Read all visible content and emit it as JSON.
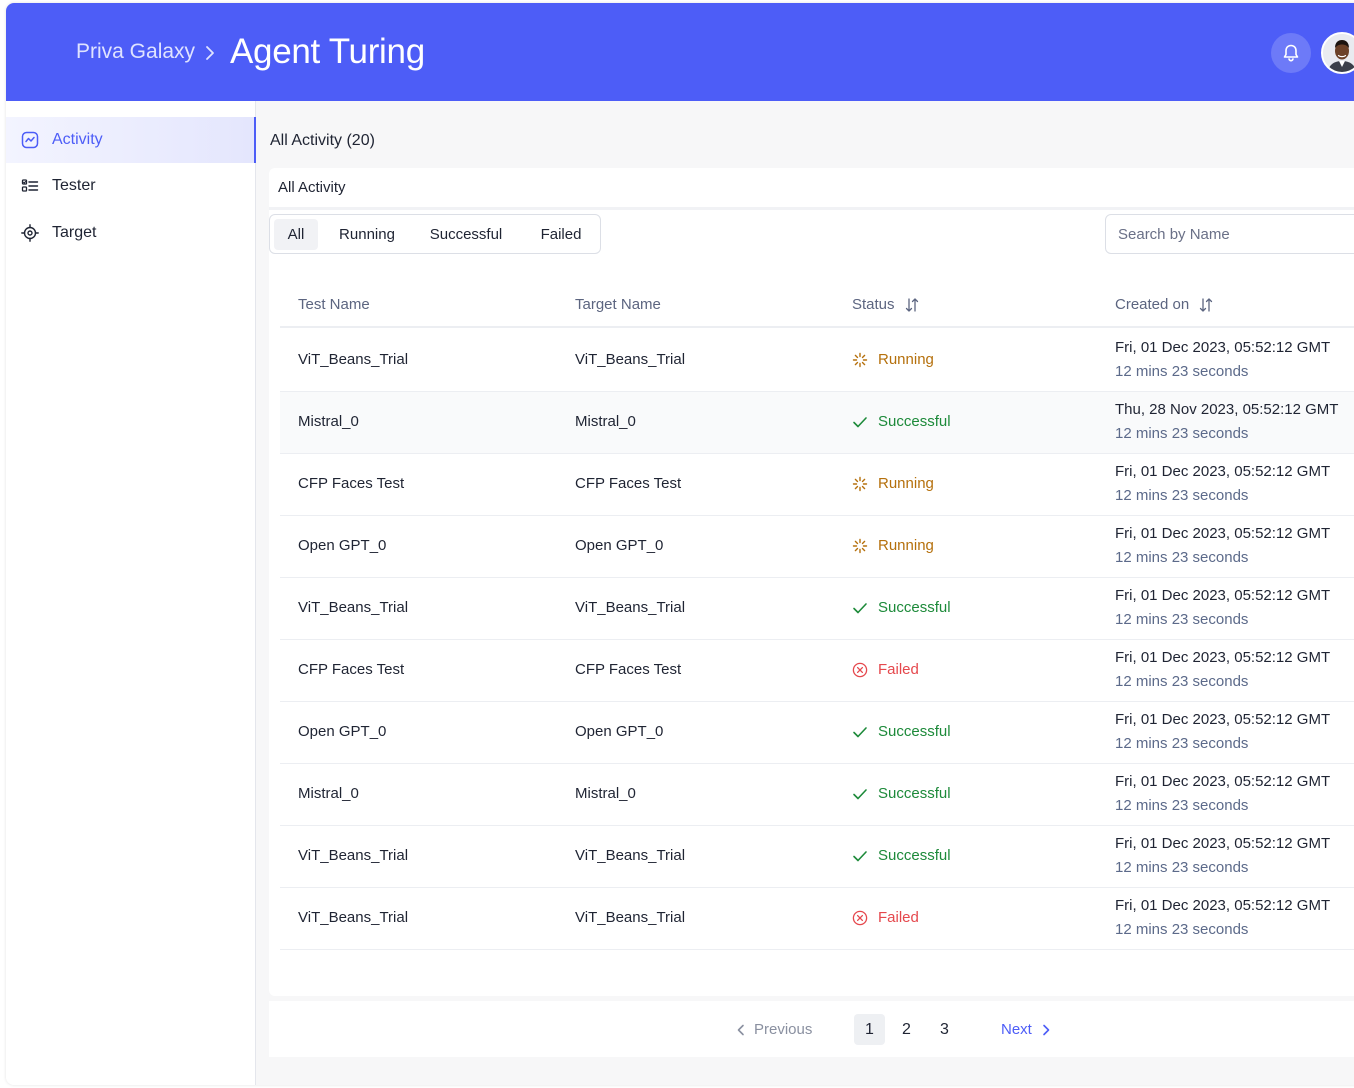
{
  "header": {
    "parent": "Priva Galaxy",
    "title": "Agent Turing",
    "bell_icon": "bell-icon",
    "avatar_icon": "user-avatar"
  },
  "sidebar": {
    "items": [
      {
        "label": "Activity",
        "icon": "activity-chart-icon",
        "active": true
      },
      {
        "label": "Tester",
        "icon": "checklist-icon",
        "active": false
      },
      {
        "label": "Target",
        "icon": "target-icon",
        "active": false
      }
    ]
  },
  "main": {
    "heading": "All Activity (20)",
    "card_title": "All Activity",
    "filters": [
      "All",
      "Running",
      "Successful",
      "Failed"
    ],
    "active_filter": "All",
    "search_placeholder": "Search by Name"
  },
  "table": {
    "columns": {
      "test_name": "Test Name",
      "target_name": "Target Name",
      "status": "Status",
      "created_on": "Created on"
    },
    "rows": [
      {
        "test": "ViT_Beans_Trial",
        "target": "ViT_Beans_Trial",
        "status": "Running",
        "date": "Fri, 01 Dec 2023, 05:52:12 GMT",
        "ago": "12 mins 23 seconds"
      },
      {
        "test": "Mistral_0",
        "target": "Mistral_0",
        "status": "Successful",
        "date": "Thu, 28 Nov 2023, 05:52:12 GMT",
        "ago": "12 mins 23 seconds"
      },
      {
        "test": "CFP Faces Test",
        "target": "CFP Faces Test",
        "status": "Running",
        "date": "Fri, 01 Dec 2023, 05:52:12 GMT",
        "ago": "12 mins 23 seconds"
      },
      {
        "test": "Open GPT_0",
        "target": "Open GPT_0",
        "status": "Running",
        "date": "Fri, 01 Dec 2023, 05:52:12 GMT",
        "ago": "12 mins 23 seconds"
      },
      {
        "test": "ViT_Beans_Trial",
        "target": "ViT_Beans_Trial",
        "status": "Successful",
        "date": "Fri, 01 Dec 2023, 05:52:12 GMT",
        "ago": "12 mins 23 seconds"
      },
      {
        "test": "CFP Faces Test",
        "target": "CFP Faces Test",
        "status": "Failed",
        "date": "Fri, 01 Dec 2023, 05:52:12 GMT",
        "ago": "12 mins 23 seconds"
      },
      {
        "test": "Open GPT_0",
        "target": "Open GPT_0",
        "status": "Successful",
        "date": "Fri, 01 Dec 2023, 05:52:12 GMT",
        "ago": "12 mins 23 seconds"
      },
      {
        "test": "Mistral_0",
        "target": "Mistral_0",
        "status": "Successful",
        "date": "Fri, 01 Dec 2023, 05:52:12 GMT",
        "ago": "12 mins 23 seconds"
      },
      {
        "test": "ViT_Beans_Trial",
        "target": "ViT_Beans_Trial",
        "status": "Successful",
        "date": "Fri, 01 Dec 2023, 05:52:12 GMT",
        "ago": "12 mins 23 seconds"
      },
      {
        "test": "ViT_Beans_Trial",
        "target": "ViT_Beans_Trial",
        "status": "Failed",
        "date": "Fri, 01 Dec 2023, 05:52:12 GMT",
        "ago": "12 mins 23 seconds"
      }
    ]
  },
  "pagination": {
    "previous": "Previous",
    "pages": [
      "1",
      "2",
      "3"
    ],
    "current": "1",
    "next": "Next"
  },
  "colors": {
    "brand": "#4d5df7",
    "running": "#b5700c",
    "successful": "#1d8a3a",
    "failed": "#e5484d"
  }
}
